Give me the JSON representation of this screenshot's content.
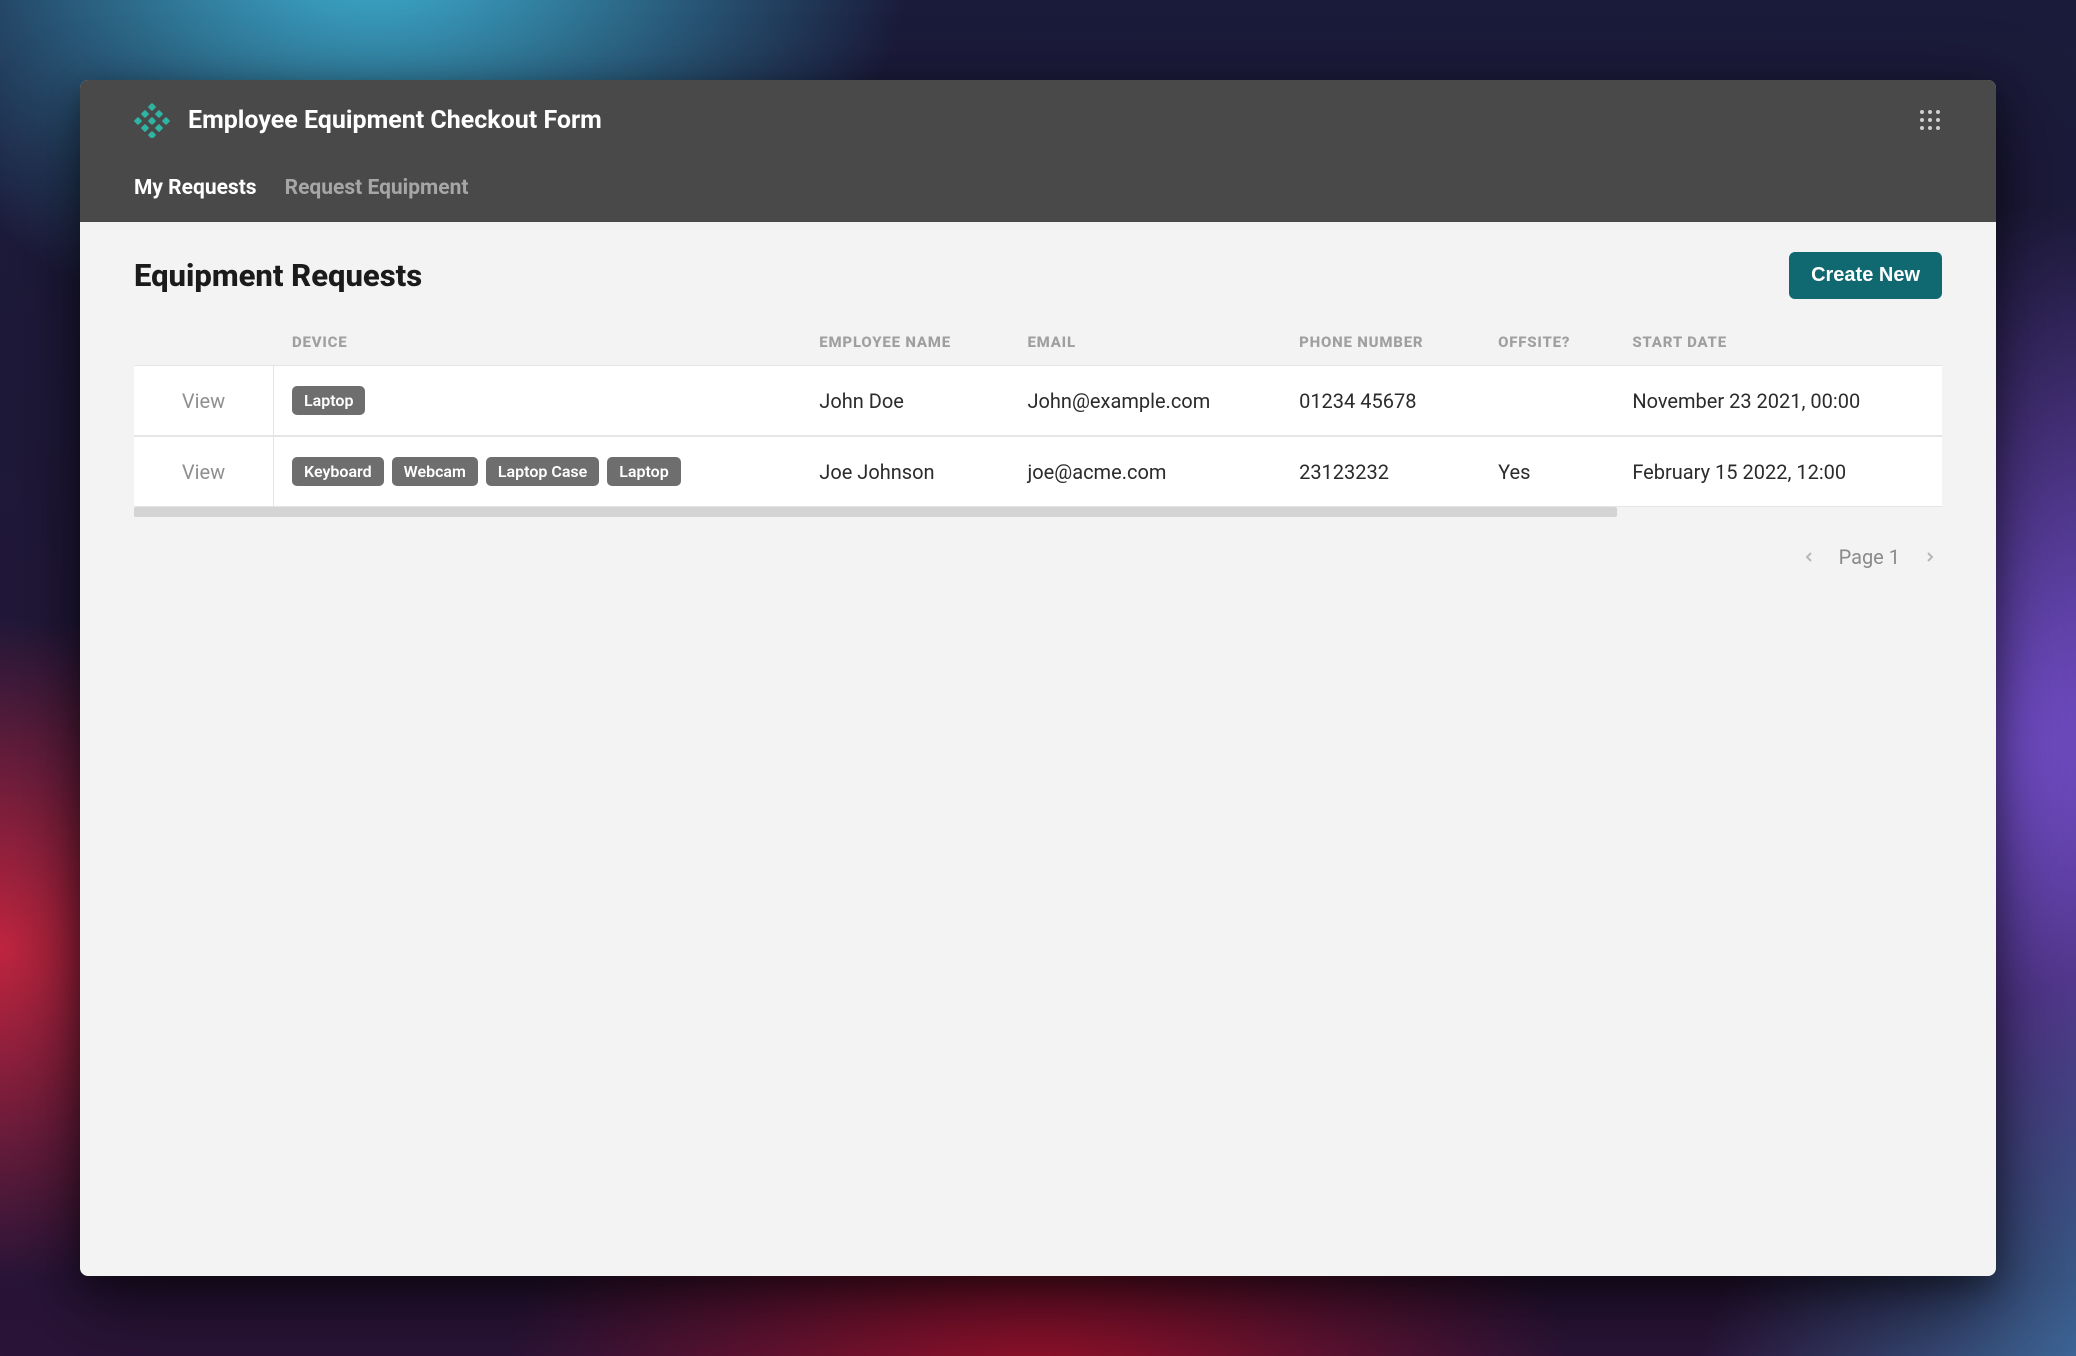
{
  "header": {
    "title": "Employee Equipment Checkout Form",
    "tabs": [
      {
        "label": "My Requests",
        "active": true
      },
      {
        "label": "Request Equipment",
        "active": false
      }
    ]
  },
  "page": {
    "title": "Equipment Requests",
    "create_label": "Create New"
  },
  "table": {
    "columns": {
      "device": "DEVICE",
      "employee_name": "EMPLOYEE NAME",
      "email": "EMAIL",
      "phone": "PHONE NUMBER",
      "offsite": "OFFSITE?",
      "start_date": "START DATE"
    },
    "view_label": "View",
    "rows": [
      {
        "devices": [
          "Laptop"
        ],
        "employee_name": "John Doe",
        "email": "John@example.com",
        "phone": "01234 45678",
        "offsite": "",
        "start_date": "November 23 2021, 00:00"
      },
      {
        "devices": [
          "Keyboard",
          "Webcam",
          "Laptop Case",
          "Laptop"
        ],
        "employee_name": "Joe Johnson",
        "email": "joe@acme.com",
        "phone": "23123232",
        "offsite": "Yes",
        "start_date": "February 15 2022, 12:00"
      }
    ]
  },
  "pagination": {
    "label": "Page 1"
  },
  "colors": {
    "accent": "#106971",
    "chip_bg": "#6e6e6e",
    "header_bg": "#494949"
  }
}
